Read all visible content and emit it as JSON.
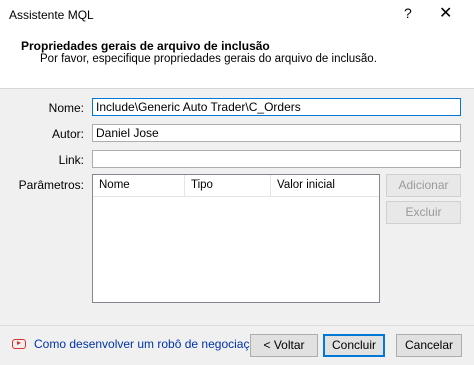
{
  "window": {
    "title": "Assistente MQL",
    "help_glyph": "?",
    "close_glyph": "✕"
  },
  "header": {
    "title": "Propriedades gerais de arquivo de inclusão",
    "subtitle": "Por favor, especifique propriedades gerais do arquivo de inclusão."
  },
  "form": {
    "name_label": "Nome:",
    "name_value": "Include\\Generic Auto Trader\\C_Orders",
    "author_label": "Autor:",
    "author_value": "Daniel Jose",
    "link_label": "Link:",
    "link_value": "",
    "params_label": "Parâmetros:"
  },
  "params_table": {
    "columns": [
      "Nome",
      "Tipo",
      "Valor inicial"
    ],
    "rows": []
  },
  "side_buttons": {
    "add": "Adicionar",
    "delete": "Excluir"
  },
  "footer": {
    "help_link": "Como desenvolver um robô de negociação",
    "back": "< Voltar",
    "finish": "Concluir",
    "cancel": "Cancelar"
  },
  "icons": {
    "help_link_icon": "youtube-icon",
    "accent": "#0078d7",
    "link_color": "#0033aa",
    "icon_red": "#e03030"
  }
}
